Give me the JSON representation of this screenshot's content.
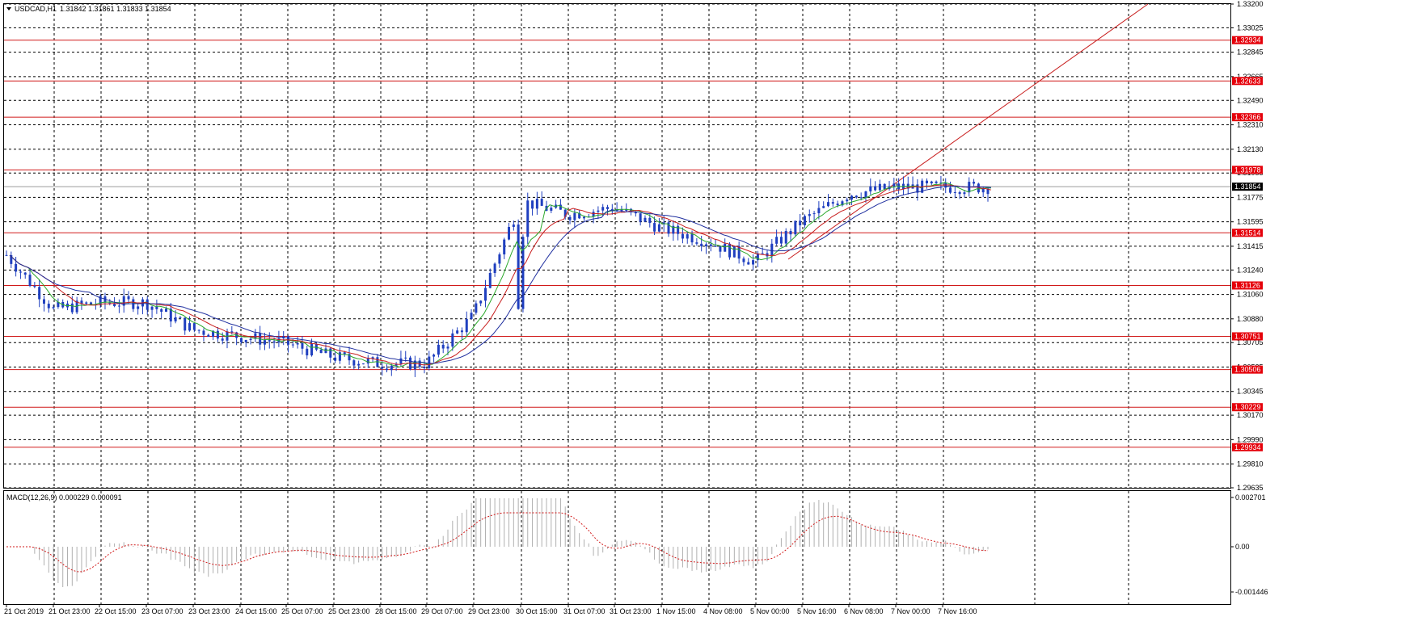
{
  "header": {
    "menu_icon": "triangle-down-icon",
    "symbol": "USDCAD,H1",
    "ohlc": "1.31842 1.31861 1.31833 1.31854"
  },
  "price_axis": {
    "ticks": [
      "1.33200",
      "1.33025",
      "1.32845",
      "1.32665",
      "1.32490",
      "1.32310",
      "1.32130",
      "1.31955",
      "1.31775",
      "1.31595",
      "1.31415",
      "1.31240",
      "1.31060",
      "1.30880",
      "1.30705",
      "1.30525",
      "1.30345",
      "1.30170",
      "1.29990",
      "1.29810",
      "1.29635"
    ],
    "current_price": "1.31854"
  },
  "levels": [
    "1.32934",
    "1.32633",
    "1.32366",
    "1.31978",
    "1.31514",
    "1.31126",
    "1.30751",
    "1.30506",
    "1.30229",
    "1.29934"
  ],
  "macd": {
    "label": "MACD(12,26,9) 0.000229 0.000091",
    "ticks": [
      "0.002701",
      "0.00",
      "-0.001446"
    ]
  },
  "time_axis": {
    "labels": [
      "21 Oct 2019",
      "21 Oct 23:00",
      "22 Oct 15:00",
      "23 Oct 07:00",
      "23 Oct 23:00",
      "24 Oct 15:00",
      "25 Oct 07:00",
      "25 Oct 23:00",
      "28 Oct 15:00",
      "29 Oct 07:00",
      "29 Oct 23:00",
      "30 Oct 15:00",
      "31 Oct 07:00",
      "31 Oct 23:00",
      "1 Nov 15:00",
      "4 Nov 08:00",
      "5 Nov 00:00",
      "5 Nov 16:00",
      "6 Nov 08:00",
      "7 Nov 00:00",
      "7 Nov 16:00"
    ]
  },
  "colors": {
    "candles": "#1f3fbf",
    "ma_fast": "#2aa82a",
    "ma_mid": "#c81e1e",
    "ma_slow": "#1f2f9f",
    "levels": "#d11a1a",
    "grid": "#000000",
    "macd_hist": "#b0b0b0",
    "macd_signal": "#d11a1a",
    "label_bg": "#e5000a"
  },
  "chart_data": {
    "type": "line",
    "title": "USDCAD,H1",
    "series": [
      {
        "name": "",
        "x": [
          "21 Oct 2019",
          "21 Oct 23:00",
          "22 Oct 15:00",
          "23 Oct 07:00",
          "23 Oct 23:00",
          "24 Oct 15:00",
          "25 Oct 07:00",
          "25 Oct 23:00",
          "28 Oct 15:00",
          "29 Oct 07:00",
          "29 Oct 23:00",
          "30 Oct 15:00",
          "31 Oct 07:00",
          "31 Oct 23:00",
          "1 Nov 15:00",
          "4 Nov 08:00",
          "5 Nov 00:00",
          "5 Nov 16:00",
          "6 Nov 08:00",
          "7 Nov 00:00",
          "7 Nov 16:00"
        ],
        "values": [
          1.3135,
          1.3095,
          1.31,
          1.31,
          1.308,
          1.3075,
          1.307,
          1.306,
          1.3055,
          1.3055,
          1.309,
          1.3175,
          1.3165,
          1.317,
          1.3155,
          1.3145,
          1.313,
          1.316,
          1.318,
          1.3185,
          1.3185
        ]
      }
    ],
    "ylim": [
      1.29635,
      1.332
    ],
    "grid": true
  }
}
